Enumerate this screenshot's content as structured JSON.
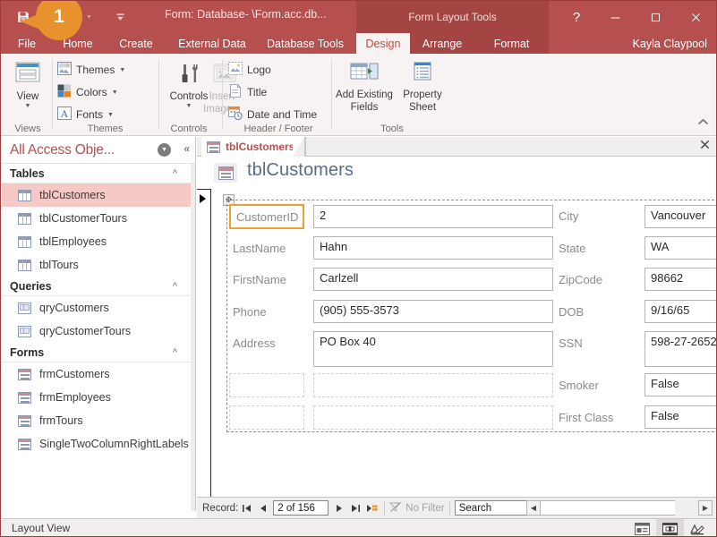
{
  "titlebar": {
    "window_title": "Form: Database- \\Form.acc.db...",
    "contextual_tools_title": "Form Layout Tools",
    "user_name": "Kayla Claypool",
    "quick_access": [
      {
        "name": "save-icon",
        "glyph": "💾"
      },
      {
        "name": "undo-icon",
        "glyph": "↶"
      },
      {
        "name": "redo-icon",
        "glyph": "↷"
      },
      {
        "name": "customize-qat-icon",
        "glyph": "⩝"
      }
    ],
    "window_controls": [
      {
        "name": "help-button",
        "glyph": "?"
      },
      {
        "name": "minimize-button",
        "glyph": "—"
      },
      {
        "name": "maximize-button",
        "glyph": "☐"
      },
      {
        "name": "close-button",
        "glyph": "✕"
      }
    ],
    "callout_number": "1"
  },
  "ribbon": {
    "tabs": [
      {
        "label": "File",
        "active": false,
        "contextual": false
      },
      {
        "label": "Home",
        "active": false,
        "contextual": false
      },
      {
        "label": "Create",
        "active": false,
        "contextual": false
      },
      {
        "label": "External Data",
        "active": false,
        "contextual": false
      },
      {
        "label": "Database Tools",
        "active": false,
        "contextual": false
      },
      {
        "label": "Design",
        "active": true,
        "contextual": true
      },
      {
        "label": "Arrange",
        "active": false,
        "contextual": true
      },
      {
        "label": "Format",
        "active": false,
        "contextual": true
      }
    ],
    "groups": {
      "views": {
        "label": "Views",
        "view_button": "View",
        "view_icon": "view-icon"
      },
      "themes": {
        "label": "Themes",
        "items": [
          {
            "label": "Themes",
            "icon": "themes-icon",
            "has_caret": true
          },
          {
            "label": "Colors",
            "icon": "colors-icon",
            "has_caret": true
          },
          {
            "label": "Fonts",
            "icon": "fonts-icon",
            "has_caret": true
          }
        ]
      },
      "controls": {
        "label": "Controls",
        "controls_button": "Controls",
        "insert_image_button_line1": "Insert",
        "insert_image_button_line2": "Image"
      },
      "header_footer": {
        "label": "Header / Footer",
        "items": [
          {
            "label": "Logo",
            "icon": "logo-icon"
          },
          {
            "label": "Title",
            "icon": "title-icon"
          },
          {
            "label": "Date and Time",
            "icon": "date-time-icon"
          }
        ]
      },
      "tools": {
        "label": "Tools",
        "add_existing_fields_line1": "Add Existing",
        "add_existing_fields_line2": "Fields",
        "property_sheet_line1": "Property",
        "property_sheet_line2": "Sheet"
      }
    },
    "collapse_icon": "chevron-up-icon"
  },
  "navpane": {
    "title": "All Access Obje...",
    "dropdown_icon": "chevron-down-icon",
    "collapse_icon": "double-chevron-left-icon",
    "groups": [
      {
        "name": "Tables",
        "icon_type": "table",
        "items": [
          {
            "label": "tblCustomers",
            "selected": true
          },
          {
            "label": "tblCustomerTours",
            "selected": false
          },
          {
            "label": "tblEmployees",
            "selected": false
          },
          {
            "label": "tblTours",
            "selected": false
          }
        ]
      },
      {
        "name": "Queries",
        "icon_type": "query",
        "items": [
          {
            "label": "qryCustomers",
            "selected": false
          },
          {
            "label": "qryCustomerTours",
            "selected": false
          }
        ]
      },
      {
        "name": "Forms",
        "icon_type": "form",
        "items": [
          {
            "label": "frmCustomers",
            "selected": false
          },
          {
            "label": "frmEmployees",
            "selected": false
          },
          {
            "label": "frmTours",
            "selected": false
          },
          {
            "label": "SingleTwoColumnRightLabels",
            "selected": false
          }
        ]
      }
    ]
  },
  "document": {
    "tab_label": "tblCustomers",
    "tab_icon": "form-icon",
    "close_icon": "close-icon",
    "form_title": "tblCustomers",
    "form_title_icon": "form-icon"
  },
  "form_fields": {
    "left_column": [
      {
        "label": "CustomerID",
        "value": "2",
        "selected_label": true,
        "tall": false
      },
      {
        "label": "LastName",
        "value": "Hahn",
        "selected_label": false,
        "tall": false
      },
      {
        "label": "FirstName",
        "value": "Carlzell",
        "selected_label": false,
        "tall": false
      },
      {
        "label": "Phone",
        "value": "(905) 555-3573",
        "selected_label": false,
        "tall": false
      },
      {
        "label": "Address",
        "value": "PO Box 40",
        "selected_label": false,
        "tall": true
      }
    ],
    "right_column": [
      {
        "label": "City",
        "value": "Vancouver"
      },
      {
        "label": "State",
        "value": "WA"
      },
      {
        "label": "ZipCode",
        "value": "98662"
      },
      {
        "label": "DOB",
        "value": "9/16/65"
      },
      {
        "label": "SSN",
        "value": "598-27-2652"
      },
      {
        "label": "Smoker",
        "value": "False"
      },
      {
        "label": "First Class",
        "value": "False"
      }
    ]
  },
  "record_nav": {
    "record_label": "Record:",
    "first_icon": "first-record-icon",
    "prev_icon": "previous-record-icon",
    "position": "2 of 156",
    "next_icon": "next-record-icon",
    "last_icon": "last-record-icon",
    "new_icon": "new-record-icon",
    "filter_label": "No Filter",
    "filter_icon": "filter-icon",
    "search_placeholder": "Search",
    "search_value": "Search",
    "hscroll_left_icon": "scroll-left-icon",
    "hscroll_right_icon": "scroll-right-icon"
  },
  "statusbar": {
    "view_label": "Layout View",
    "view_buttons": [
      {
        "name": "form-view-button",
        "active": false
      },
      {
        "name": "layout-view-button",
        "active": true
      },
      {
        "name": "design-view-button",
        "active": false
      }
    ]
  },
  "colors": {
    "accent": "#b5504e",
    "contextual_tab": "#a54543",
    "selection_orange": "#eda032",
    "callout_orange": "#e8922e",
    "nav_selection": "#f6c8c6",
    "form_title_blue": "#5a6b8c"
  }
}
